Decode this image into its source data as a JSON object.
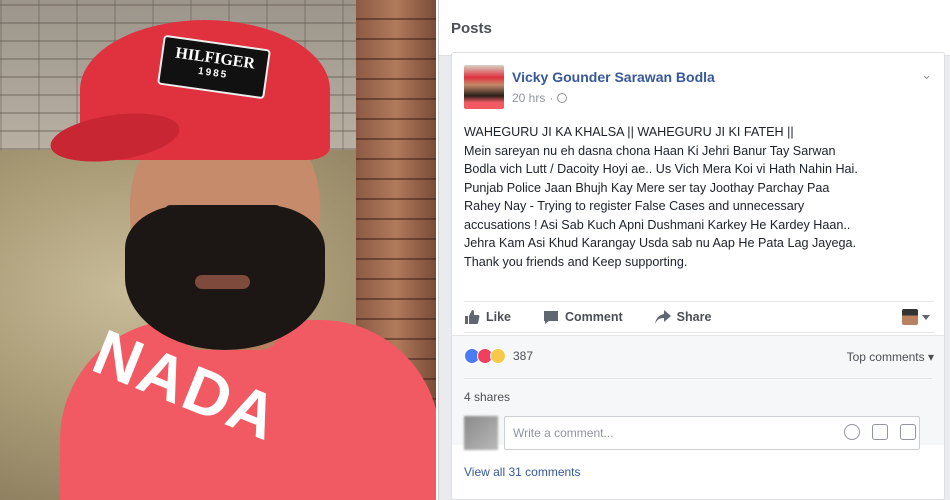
{
  "photo": {
    "cap_text_line1": "HILFIGER",
    "cap_text_line2": "1985",
    "shirt_text": "NADA"
  },
  "header": {
    "title": "Posts"
  },
  "post": {
    "author": "Vicky Gounder Sarawan Bodla",
    "time": "20 hrs",
    "audience_icon": "globe-icon",
    "text": "WAHEGURU JI KA KHALSA || WAHEGURU JI KI FATEH ||\nMein sareyan nu eh dasna chona Haan Ki Jehri Banur Tay Sarwan\nBodla vich Lutt / Dacoity Hoyi ae.. Us Vich Mera Koi vi Hath Nahin Hai.\nPunjab Police Jaan Bhujh Kay Mere ser tay Joothay Parchay Paa\nRahey Nay - Trying to register False Cases and unnecessary\naccusations ! Asi Sab Kuch Apni Dushmani Karkey He Kardey Haan..\nJehra Kam Asi Khud Karangay Usda sab nu Aap He Pata Lag Jayega.\nThank you friends and Keep supporting.",
    "actions": {
      "like": "Like",
      "comment": "Comment",
      "share": "Share"
    },
    "reactions": {
      "count": "387",
      "types": [
        "like",
        "love",
        "haha"
      ]
    },
    "top_comments_label": "Top comments",
    "shares": "4 shares",
    "comment_placeholder": "Write a comment...",
    "view_all_comments": "View all 31 comments"
  },
  "colors": {
    "link": "#365899",
    "like": "#4a7cf3",
    "love": "#f0405e",
    "haha": "#f7c94a",
    "cap": "#e0313e",
    "shirt": "#f25a63"
  }
}
